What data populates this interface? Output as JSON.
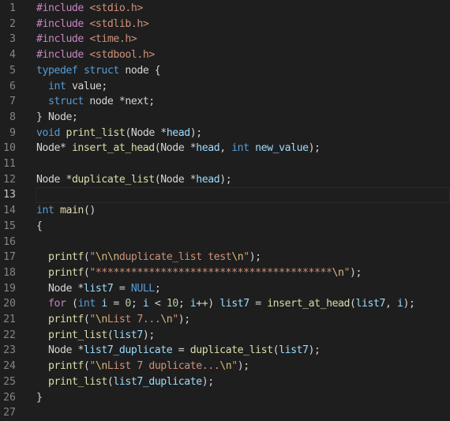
{
  "editor": {
    "language": "c",
    "active_line": 13,
    "colors": {
      "background": "#1e1e1e",
      "line_number": "#858585",
      "keyword": "#569cd6",
      "control": "#c586c0",
      "string": "#ce9178",
      "function": "#dcdcaa",
      "variable": "#9cdcfe",
      "number": "#b5cea8"
    },
    "lines": [
      {
        "n": "1",
        "tokens": [
          [
            "pp",
            "#include"
          ],
          [
            "plain",
            " "
          ],
          [
            "inc",
            "<stdio.h>"
          ]
        ]
      },
      {
        "n": "2",
        "tokens": [
          [
            "pp",
            "#include"
          ],
          [
            "plain",
            " "
          ],
          [
            "inc",
            "<stdlib.h>"
          ]
        ]
      },
      {
        "n": "3",
        "tokens": [
          [
            "pp",
            "#include"
          ],
          [
            "plain",
            " "
          ],
          [
            "inc",
            "<time.h>"
          ]
        ]
      },
      {
        "n": "4",
        "tokens": [
          [
            "pp",
            "#include"
          ],
          [
            "plain",
            " "
          ],
          [
            "inc",
            "<stdbool.h>"
          ]
        ]
      },
      {
        "n": "5",
        "tokens": [
          [
            "kw",
            "typedef"
          ],
          [
            "plain",
            " "
          ],
          [
            "kw",
            "struct"
          ],
          [
            "plain",
            " node {"
          ]
        ]
      },
      {
        "n": "6",
        "tokens": [
          [
            "plain",
            "  "
          ],
          [
            "kw",
            "int"
          ],
          [
            "plain",
            " value;"
          ]
        ]
      },
      {
        "n": "7",
        "tokens": [
          [
            "plain",
            "  "
          ],
          [
            "kw",
            "struct"
          ],
          [
            "plain",
            " node *next;"
          ]
        ]
      },
      {
        "n": "8",
        "tokens": [
          [
            "plain",
            "} Node;"
          ]
        ]
      },
      {
        "n": "9",
        "tokens": [
          [
            "kw",
            "void"
          ],
          [
            "plain",
            " "
          ],
          [
            "fn",
            "print_list"
          ],
          [
            "plain",
            "(Node *"
          ],
          [
            "var",
            "head"
          ],
          [
            "plain",
            ");"
          ]
        ]
      },
      {
        "n": "10",
        "tokens": [
          [
            "plain",
            "Node* "
          ],
          [
            "fn",
            "insert_at_head"
          ],
          [
            "plain",
            "(Node *"
          ],
          [
            "var",
            "head"
          ],
          [
            "plain",
            ", "
          ],
          [
            "kw",
            "int"
          ],
          [
            "plain",
            " "
          ],
          [
            "var",
            "new_value"
          ],
          [
            "plain",
            ");"
          ]
        ]
      },
      {
        "n": "11",
        "tokens": []
      },
      {
        "n": "12",
        "tokens": [
          [
            "plain",
            "Node *"
          ],
          [
            "fn",
            "duplicate_list"
          ],
          [
            "plain",
            "(Node *"
          ],
          [
            "var",
            "head"
          ],
          [
            "plain",
            ");"
          ]
        ]
      },
      {
        "n": "13",
        "tokens": []
      },
      {
        "n": "14",
        "tokens": [
          [
            "kw",
            "int"
          ],
          [
            "plain",
            " "
          ],
          [
            "fn",
            "main"
          ],
          [
            "plain",
            "()"
          ]
        ]
      },
      {
        "n": "15",
        "tokens": [
          [
            "plain",
            "{"
          ]
        ]
      },
      {
        "n": "16",
        "tokens": []
      },
      {
        "n": "17",
        "tokens": [
          [
            "plain",
            "  "
          ],
          [
            "fn",
            "printf"
          ],
          [
            "plain",
            "("
          ],
          [
            "str",
            "\""
          ],
          [
            "esc",
            "\\n\\n"
          ],
          [
            "str",
            "duplicate_list test"
          ],
          [
            "esc",
            "\\n"
          ],
          [
            "str",
            "\""
          ],
          [
            "plain",
            ");"
          ]
        ]
      },
      {
        "n": "18",
        "tokens": [
          [
            "plain",
            "  "
          ],
          [
            "fn",
            "printf"
          ],
          [
            "plain",
            "("
          ],
          [
            "str",
            "\"****************************************"
          ],
          [
            "esc",
            "\\n"
          ],
          [
            "str",
            "\""
          ],
          [
            "plain",
            ");"
          ]
        ]
      },
      {
        "n": "19",
        "tokens": [
          [
            "plain",
            "  Node *"
          ],
          [
            "var",
            "list7"
          ],
          [
            "plain",
            " = "
          ],
          [
            "kw",
            "NULL"
          ],
          [
            "plain",
            ";"
          ]
        ]
      },
      {
        "n": "20",
        "tokens": [
          [
            "plain",
            "  "
          ],
          [
            "ctl",
            "for"
          ],
          [
            "plain",
            " ("
          ],
          [
            "kw",
            "int"
          ],
          [
            "plain",
            " "
          ],
          [
            "var",
            "i"
          ],
          [
            "plain",
            " = "
          ],
          [
            "num",
            "0"
          ],
          [
            "plain",
            "; "
          ],
          [
            "var",
            "i"
          ],
          [
            "plain",
            " < "
          ],
          [
            "num",
            "10"
          ],
          [
            "plain",
            "; "
          ],
          [
            "var",
            "i"
          ],
          [
            "plain",
            "++) "
          ],
          [
            "var",
            "list7"
          ],
          [
            "plain",
            " = "
          ],
          [
            "fn",
            "insert_at_head"
          ],
          [
            "plain",
            "("
          ],
          [
            "var",
            "list7"
          ],
          [
            "plain",
            ", "
          ],
          [
            "var",
            "i"
          ],
          [
            "plain",
            ");"
          ]
        ]
      },
      {
        "n": "21",
        "tokens": [
          [
            "plain",
            "  "
          ],
          [
            "fn",
            "printf"
          ],
          [
            "plain",
            "("
          ],
          [
            "str",
            "\""
          ],
          [
            "esc",
            "\\n"
          ],
          [
            "str",
            "List 7..."
          ],
          [
            "esc",
            "\\n"
          ],
          [
            "str",
            "\""
          ],
          [
            "plain",
            ");"
          ]
        ]
      },
      {
        "n": "22",
        "tokens": [
          [
            "plain",
            "  "
          ],
          [
            "fn",
            "print_list"
          ],
          [
            "plain",
            "("
          ],
          [
            "var",
            "list7"
          ],
          [
            "plain",
            ");"
          ]
        ]
      },
      {
        "n": "23",
        "tokens": [
          [
            "plain",
            "  Node *"
          ],
          [
            "var",
            "list7_duplicate"
          ],
          [
            "plain",
            " = "
          ],
          [
            "fn",
            "duplicate_list"
          ],
          [
            "plain",
            "("
          ],
          [
            "var",
            "list7"
          ],
          [
            "plain",
            ");"
          ]
        ]
      },
      {
        "n": "24",
        "tokens": [
          [
            "plain",
            "  "
          ],
          [
            "fn",
            "printf"
          ],
          [
            "plain",
            "("
          ],
          [
            "str",
            "\""
          ],
          [
            "esc",
            "\\n"
          ],
          [
            "str",
            "List 7 duplicate..."
          ],
          [
            "esc",
            "\\n"
          ],
          [
            "str",
            "\""
          ],
          [
            "plain",
            ");"
          ]
        ]
      },
      {
        "n": "25",
        "tokens": [
          [
            "plain",
            "  "
          ],
          [
            "fn",
            "print_list"
          ],
          [
            "plain",
            "("
          ],
          [
            "var",
            "list7_duplicate"
          ],
          [
            "plain",
            ");"
          ]
        ]
      },
      {
        "n": "26",
        "tokens": [
          [
            "plain",
            "}"
          ]
        ]
      },
      {
        "n": "27",
        "tokens": []
      }
    ]
  }
}
